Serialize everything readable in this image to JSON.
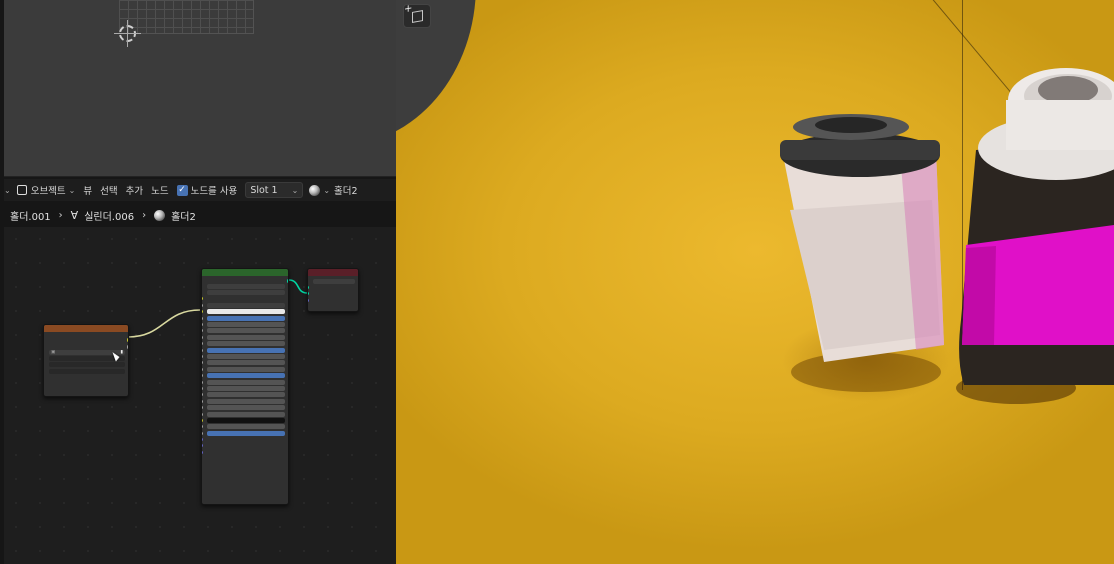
{
  "node_editor_header": {
    "object_label": "오브젝트",
    "view_label": "뷰",
    "select_label": "선택",
    "add_label": "추가",
    "node_label": "노드",
    "use_nodes_label": "노드를 사용",
    "slot_label": "Slot 1",
    "material_name": "홀더2"
  },
  "breadcrumb": {
    "object": "홀더.001",
    "mesh": "실린더.006",
    "material": "홀더2"
  },
  "colors": {
    "editor_bg": "#1e1e1e",
    "shader_header": "#2b652b",
    "output_header": "#5a1f28",
    "texture_header": "#8a4a22",
    "accent": "#4772b3",
    "floor_yellow": "#dcaa20",
    "sleeve_magenta": "#e010c8"
  },
  "icons": [
    "object-icon",
    "checkbox-checked-icon",
    "sphere-material-icon",
    "mesh-icon",
    "add-cube-icon",
    "mouse-cursor-icon"
  ]
}
